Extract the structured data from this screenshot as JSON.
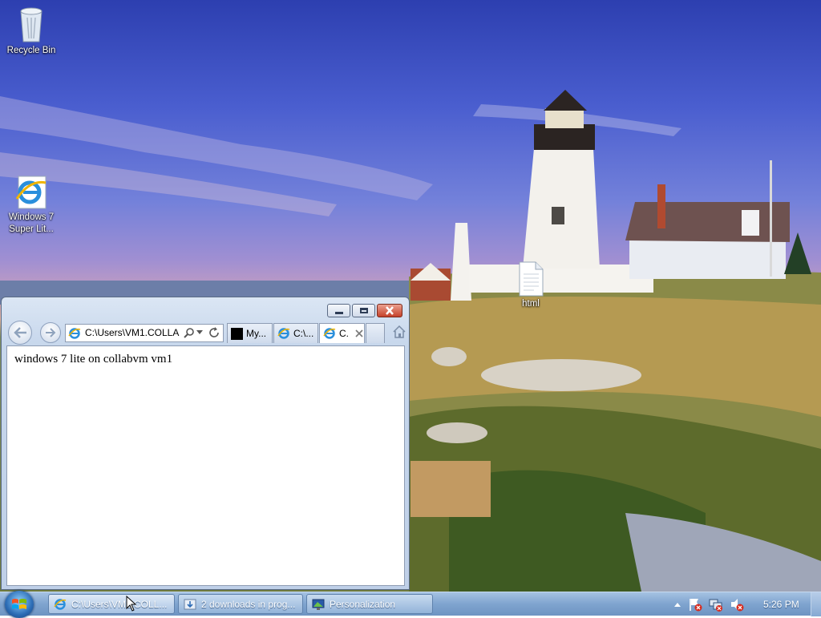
{
  "desktop": {
    "icons": [
      {
        "label": "Recycle Bin",
        "icon": "recycle-bin-icon"
      },
      {
        "label": "Windows 7 Super Lit...",
        "icon": "internet-explorer-icon"
      },
      {
        "label": "html",
        "icon": "document-file-icon"
      }
    ]
  },
  "browser": {
    "address": "C:\\Users\\VM1.COLLAB",
    "tabs": [
      {
        "label": "My...",
        "icon": "black-square-icon"
      },
      {
        "label": "C:\\...",
        "icon": "internet-explorer-icon"
      },
      {
        "label": "C.",
        "icon": "internet-explorer-icon",
        "active": true
      }
    ],
    "page_text": "windows 7 lite on collabvm vm1"
  },
  "taskbar": {
    "buttons": [
      {
        "label": "C:\\Users\\VM1.COLL...",
        "icon": "internet-explorer-icon",
        "active": true
      },
      {
        "label": "2 downloads in prog...",
        "icon": "download-icon"
      },
      {
        "label": "Personalization",
        "icon": "personalization-icon"
      }
    ],
    "clock": "5:26 PM"
  },
  "colors": {
    "taskbar": "#7fa4cf",
    "close_button": "#c5412a",
    "sky": "#4a5ecf"
  }
}
